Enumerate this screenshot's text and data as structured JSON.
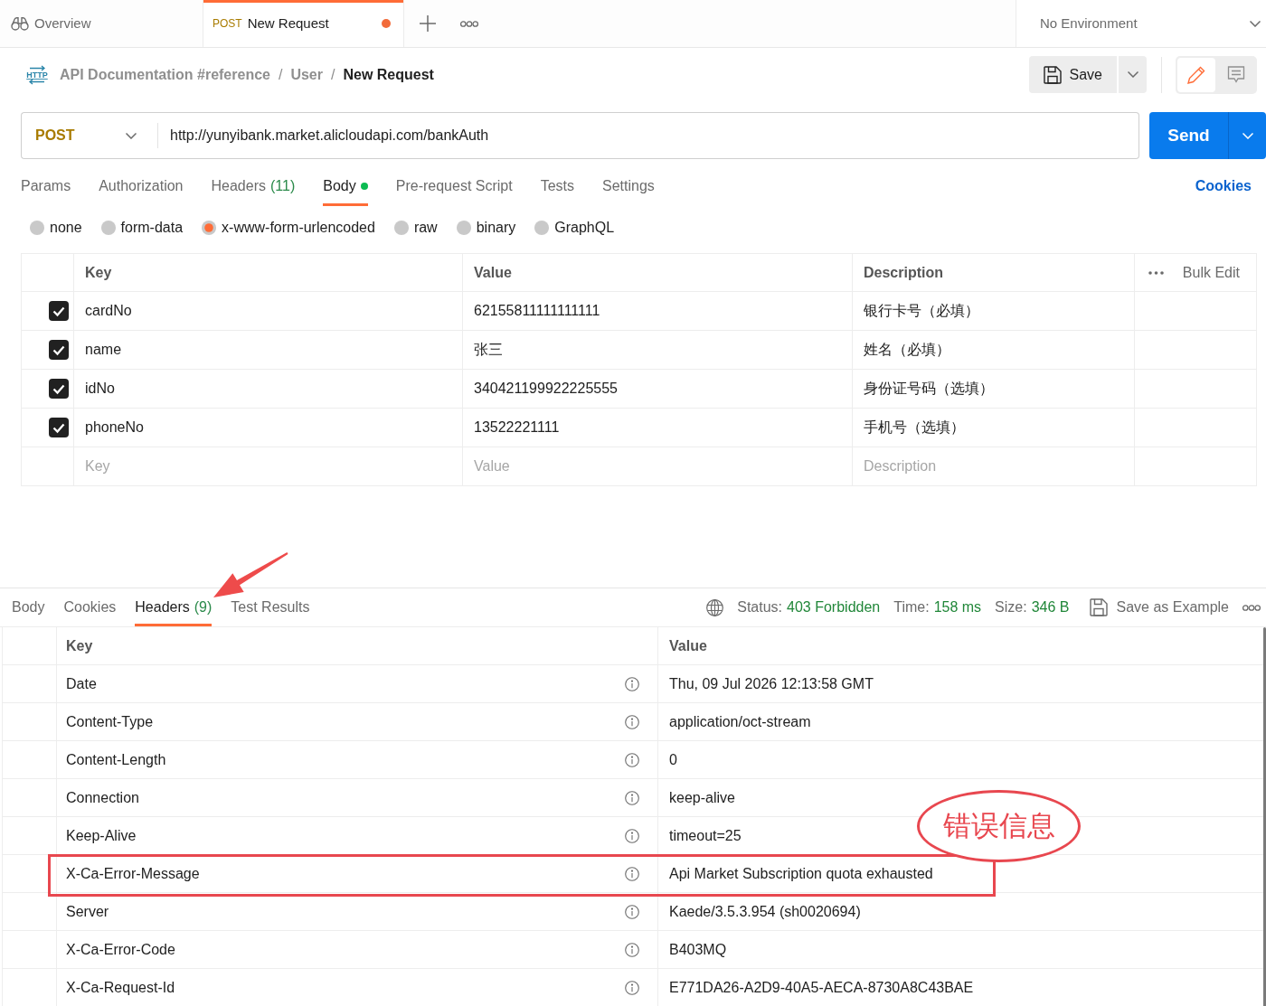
{
  "top_tabs": [
    {
      "kind": "overview",
      "label": "Overview",
      "selected": false,
      "unsaved": false
    },
    {
      "kind": "request",
      "method": "POST",
      "label": "New Request",
      "selected": true,
      "unsaved": true
    }
  ],
  "environment": {
    "label": "No Environment"
  },
  "breadcrumb": {
    "icon_text": "HTTP",
    "items": [
      {
        "label": "API Documentation #reference",
        "current": false
      },
      {
        "label": "User",
        "current": false
      },
      {
        "label": "New Request",
        "current": true
      }
    ],
    "separators": [
      "/",
      "/"
    ]
  },
  "save": {
    "label": "Save"
  },
  "view_toggle": [
    {
      "kind": "edit",
      "selected": true
    },
    {
      "kind": "comments",
      "selected": false
    }
  ],
  "request": {
    "method": "POST",
    "url": "http://yunyibank.market.alicloudapi.com/bankAuth"
  },
  "send": {
    "label": "Send"
  },
  "request_tabs": [
    {
      "label": "Params",
      "selected": false,
      "has_content": false
    },
    {
      "label": "Authorization",
      "selected": false,
      "has_content": false
    },
    {
      "label": "Headers",
      "count": "(11)",
      "selected": false,
      "has_content": false
    },
    {
      "label": "Body",
      "selected": true,
      "has_content": true
    },
    {
      "label": "Pre-request Script",
      "selected": false,
      "has_content": false
    },
    {
      "label": "Tests",
      "selected": false,
      "has_content": false
    },
    {
      "label": "Settings",
      "selected": false,
      "has_content": false
    }
  ],
  "cookies_link": "Cookies",
  "body_types": [
    {
      "label": "none",
      "selected": false
    },
    {
      "label": "form-data",
      "selected": false
    },
    {
      "label": "x-www-form-urlencoded",
      "selected": true
    },
    {
      "label": "raw",
      "selected": false
    },
    {
      "label": "binary",
      "selected": false
    },
    {
      "label": "GraphQL",
      "selected": false
    }
  ],
  "params_table": {
    "columns": [
      "Key",
      "Value",
      "Description"
    ],
    "bulk_edit": "Bulk Edit",
    "rows": [
      {
        "checked": true,
        "key": "cardNo",
        "value": "62155811111111111",
        "description": "银行卡号（必填）"
      },
      {
        "checked": true,
        "key": "name",
        "value": "张三",
        "description": "姓名（必填）"
      },
      {
        "checked": true,
        "key": "idNo",
        "value": "340421199922225555",
        "description": "身份证号码（选填）"
      },
      {
        "checked": true,
        "key": "phoneNo",
        "value": "13522221111",
        "description": "手机号（选填）"
      }
    ],
    "new_row": {
      "key": {
        "placeholder": "Key"
      },
      "value": {
        "placeholder": "Value"
      },
      "description": {
        "placeholder": "Description"
      }
    }
  },
  "response": {
    "tabs": [
      {
        "label": "Body",
        "selected": false
      },
      {
        "label": "Cookies",
        "selected": false
      },
      {
        "label": "Headers",
        "count": "(9)",
        "selected": true
      },
      {
        "label": "Test Results",
        "selected": false
      }
    ],
    "status": {
      "label": "Status:",
      "value": "403 Forbidden"
    },
    "time": {
      "label": "Time:",
      "value": "158 ms"
    },
    "size": {
      "label": "Size:",
      "value": "346 B"
    },
    "save_example": "Save as Example",
    "headers_table": {
      "columns": [
        "Key",
        "Value"
      ],
      "rows": [
        {
          "key": "Date",
          "value": "Thu, 09 Jul 2026 12:13:58 GMT",
          "highlighted": false
        },
        {
          "key": "Content-Type",
          "value": "application/oct-stream",
          "highlighted": false
        },
        {
          "key": "Content-Length",
          "value": "0",
          "highlighted": false
        },
        {
          "key": "Connection",
          "value": "keep-alive",
          "highlighted": false
        },
        {
          "key": "Keep-Alive",
          "value": "timeout=25",
          "highlighted": false
        },
        {
          "key": "X-Ca-Error-Message",
          "value": "Api Market Subscription quota exhausted",
          "highlighted": true
        },
        {
          "key": "Server",
          "value": "Kaede/3.5.3.954 (sh0020694)",
          "highlighted": false
        },
        {
          "key": "X-Ca-Error-Code",
          "value": "B403MQ",
          "highlighted": false
        },
        {
          "key": "X-Ca-Request-Id",
          "value": "E771DA26-A2D9-40A5-AECA-8730A8C43BAE",
          "highlighted": false
        }
      ]
    }
  },
  "annotations": [
    {
      "kind": "arrow"
    },
    {
      "kind": "callout",
      "text": "错误信息"
    }
  ]
}
